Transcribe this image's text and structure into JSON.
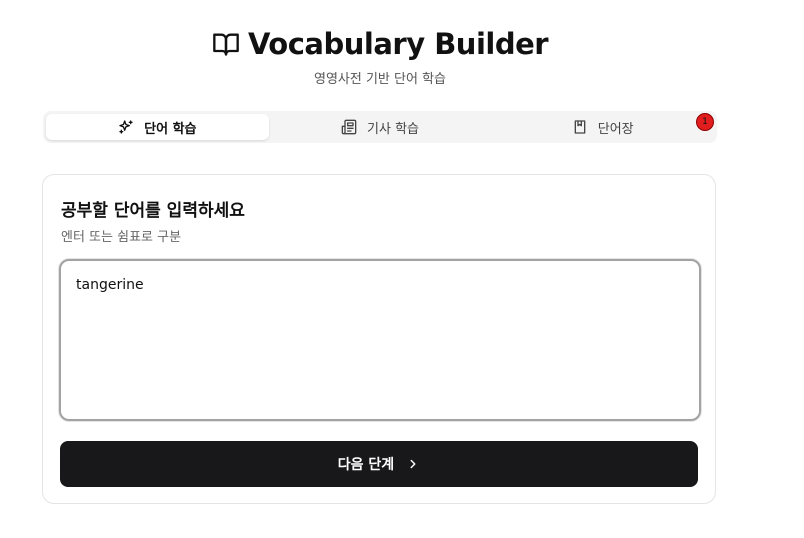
{
  "header": {
    "title": "Vocabulary Builder",
    "subtitle": "영영사전 기반 단어 학습",
    "icon": "book-open-icon"
  },
  "tabs": [
    {
      "label": "단어 학습",
      "icon": "sparkles-icon",
      "active": true
    },
    {
      "label": "기사 학습",
      "icon": "newspaper-icon",
      "active": false
    },
    {
      "label": "단어장",
      "icon": "bookmark-book-icon",
      "active": false
    }
  ],
  "wordbook_badge": "1",
  "card": {
    "title": "공부할 단어를 입력하세요",
    "description": "엔터 또는 쉼표로 구분",
    "input_value": "tangerine",
    "button_label": "다음 단계",
    "button_icon": "chevron-right-icon"
  },
  "colors": {
    "primary_button": "#18181b",
    "badge": "#e11d1d",
    "tab_bg": "#f4f4f5"
  }
}
